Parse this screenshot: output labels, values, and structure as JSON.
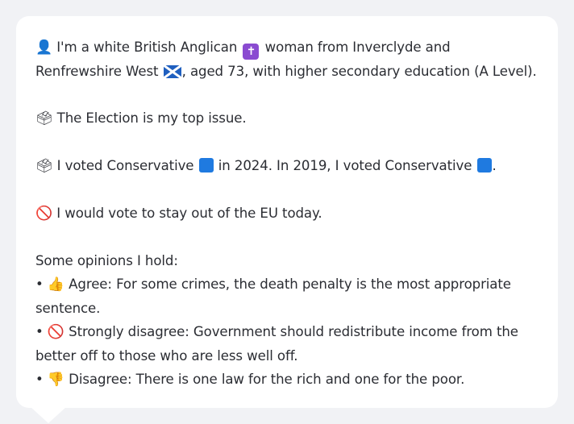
{
  "profile": {
    "intro_a": "I'm a white British Anglican",
    "intro_b": "woman from Inverclyde and Renfrewshire West",
    "intro_c": ", aged 73, with higher secondary education (A Level).",
    "person_icon": "👤",
    "cross_icon": "✝"
  },
  "issue": {
    "icon": "🗳",
    "text": "The Election is my top issue."
  },
  "votes": {
    "icon": "🗳",
    "text_a": "I voted Conservative",
    "text_b": "in 2024. In 2019, I voted Conservative",
    "text_c": "."
  },
  "eu": {
    "icon": "🚫",
    "text": "I would vote to stay out of the EU today."
  },
  "opinions": {
    "heading": "Some opinions I hold:",
    "bullet": "•",
    "items": [
      {
        "icon": "👍",
        "text": "Agree: For some crimes, the death penalty is the most appropriate sentence."
      },
      {
        "icon": "🚫",
        "text": "Strongly disagree: Government should redistribute income from the better off to those who are less well off."
      },
      {
        "icon": "👎",
        "text": "Disagree: There is one law for the rich and one for the poor."
      }
    ]
  },
  "colors": {
    "conservative_blue": "#1f7ae0",
    "anglican_purple": "#8a4bd1",
    "background": "#f1f2f5",
    "bubble": "#ffffff",
    "text": "#2b2d33"
  }
}
